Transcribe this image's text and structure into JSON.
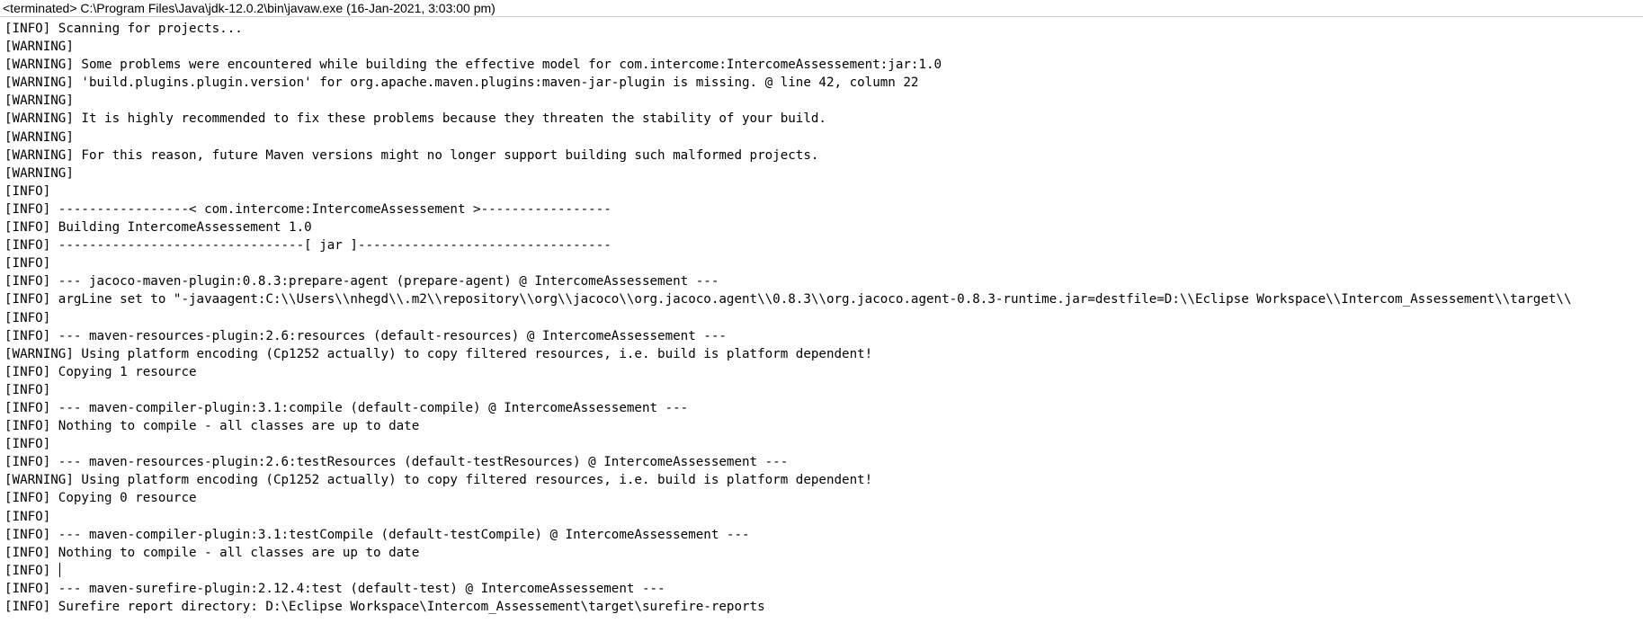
{
  "console": {
    "header": "<terminated> C:\\Program Files\\Java\\jdk-12.0.2\\bin\\javaw.exe (16-Jan-2021, 3:03:00 pm)",
    "lines": [
      "[INFO] Scanning for projects...",
      "[WARNING]",
      "[WARNING] Some problems were encountered while building the effective model for com.intercome:IntercomeAssessement:jar:1.0",
      "[WARNING] 'build.plugins.plugin.version' for org.apache.maven.plugins:maven-jar-plugin is missing. @ line 42, column 22",
      "[WARNING]",
      "[WARNING] It is highly recommended to fix these problems because they threaten the stability of your build.",
      "[WARNING]",
      "[WARNING] For this reason, future Maven versions might no longer support building such malformed projects.",
      "[WARNING]",
      "[INFO]",
      "[INFO] -----------------< com.intercome:IntercomeAssessement >-----------------",
      "[INFO] Building IntercomeAssessement 1.0",
      "[INFO] --------------------------------[ jar ]---------------------------------",
      "[INFO]",
      "[INFO] --- jacoco-maven-plugin:0.8.3:prepare-agent (prepare-agent) @ IntercomeAssessement ---",
      "[INFO] argLine set to \"-javaagent:C:\\\\Users\\\\nhegd\\\\.m2\\\\repository\\\\org\\\\jacoco\\\\org.jacoco.agent\\\\0.8.3\\\\org.jacoco.agent-0.8.3-runtime.jar=destfile=D:\\\\Eclipse Workspace\\\\Intercom_Assessement\\\\target\\\\",
      "[INFO]",
      "[INFO] --- maven-resources-plugin:2.6:resources (default-resources) @ IntercomeAssessement ---",
      "[WARNING] Using platform encoding (Cp1252 actually) to copy filtered resources, i.e. build is platform dependent!",
      "[INFO] Copying 1 resource",
      "[INFO]",
      "[INFO] --- maven-compiler-plugin:3.1:compile (default-compile) @ IntercomeAssessement ---",
      "[INFO] Nothing to compile - all classes are up to date",
      "[INFO]",
      "[INFO] --- maven-resources-plugin:2.6:testResources (default-testResources) @ IntercomeAssessement ---",
      "[WARNING] Using platform encoding (Cp1252 actually) to copy filtered resources, i.e. build is platform dependent!",
      "[INFO] Copying 0 resource",
      "[INFO]",
      "[INFO] --- maven-compiler-plugin:3.1:testCompile (default-testCompile) @ IntercomeAssessement ---",
      "[INFO] Nothing to compile - all classes are up to date",
      "[INFO] ",
      "[INFO] --- maven-surefire-plugin:2.12.4:test (default-test) @ IntercomeAssessement ---",
      "[INFO] Surefire report directory: D:\\Eclipse Workspace\\Intercom_Assessement\\target\\surefire-reports",
      "",
      "-------------------------------------------------------"
    ]
  }
}
